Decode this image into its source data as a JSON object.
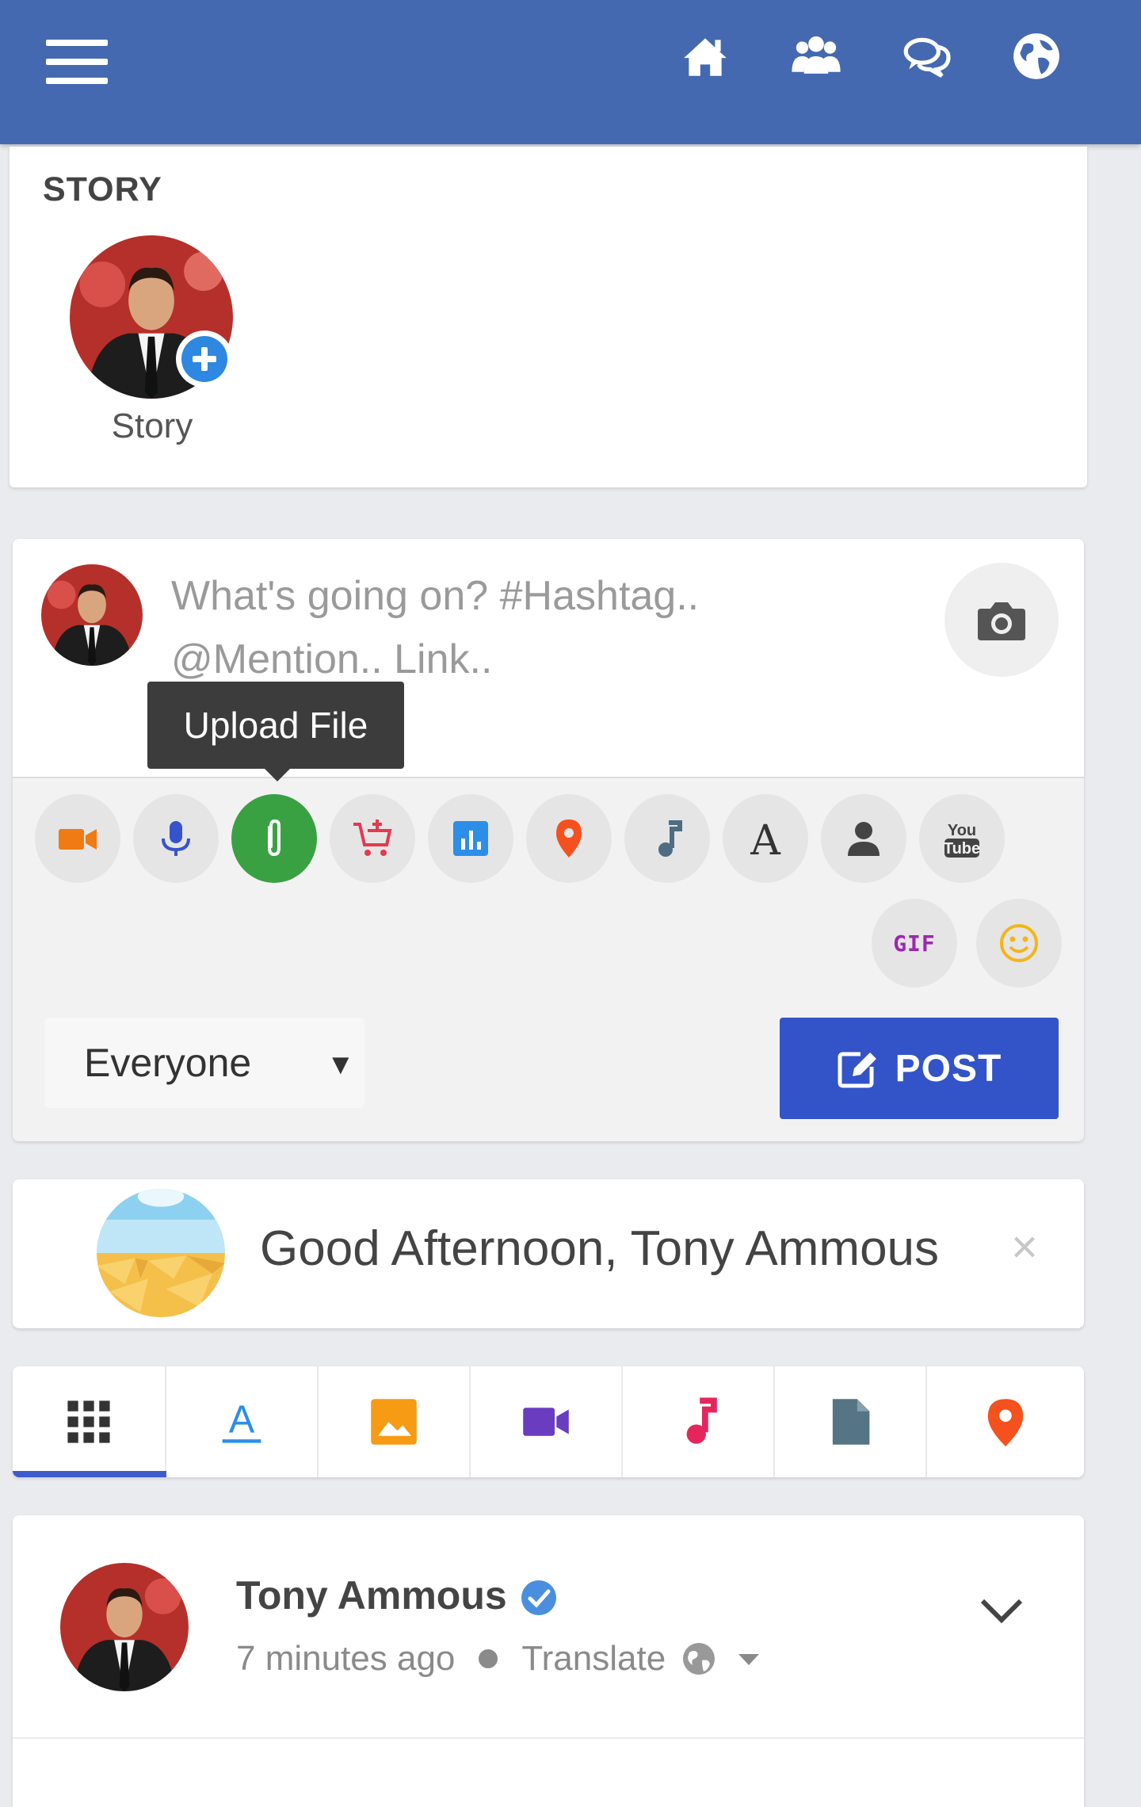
{
  "header": {
    "menu_icon": "hamburger-icon",
    "nav": [
      "home-icon",
      "groups-icon",
      "messages-icon",
      "globe-icon"
    ],
    "brand_color": "#4469b0"
  },
  "story": {
    "heading": "STORY",
    "label": "Story"
  },
  "composer": {
    "placeholder_line1": "What's going on? #Hashtag..",
    "placeholder_line2": "@Mention.. Link..",
    "tooltip": "Upload File",
    "tools": [
      "video",
      "microphone",
      "attachment",
      "product",
      "poll",
      "location",
      "music",
      "text",
      "person",
      "youtube"
    ],
    "tools_row2": [
      "gif",
      "emoji"
    ],
    "gif_label": "GIF",
    "yt_line1": "You",
    "yt_line2": "Tube",
    "privacy": "Everyone",
    "post_label": "POST",
    "post_color": "#3353c9",
    "active_color": "#3aa142"
  },
  "greeting": {
    "text": "Good Afternoon, Tony Ammous",
    "close": "×"
  },
  "filters": {
    "tabs": [
      "all",
      "text",
      "photos",
      "videos",
      "music",
      "files",
      "places"
    ],
    "active": "all",
    "text_glyph": "A"
  },
  "post": {
    "author": "Tony Ammous",
    "time": "7 minutes ago",
    "translate": "Translate"
  }
}
